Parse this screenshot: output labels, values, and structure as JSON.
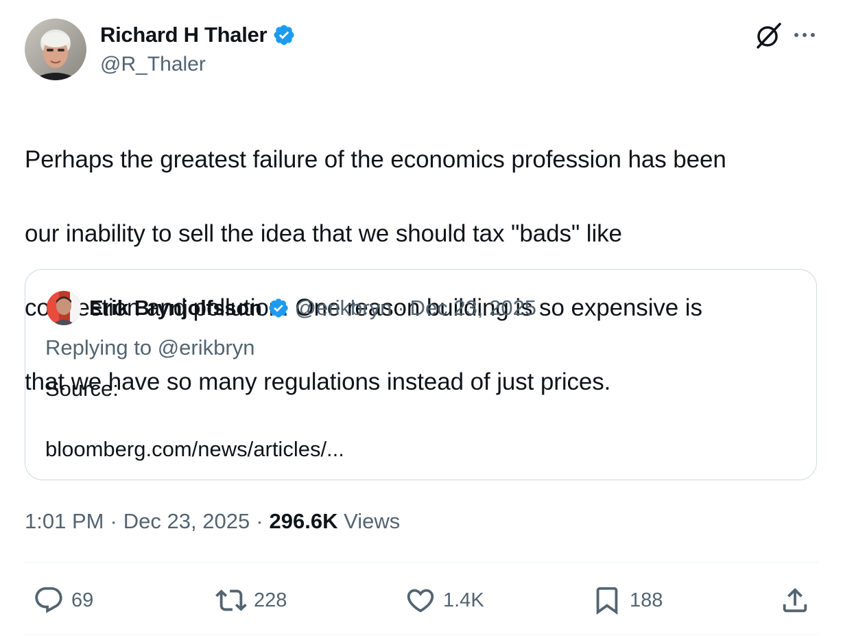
{
  "author": {
    "name": "Richard H Thaler",
    "handle": "@R_Thaler",
    "verified": true
  },
  "tweet": {
    "line1": "Perhaps the greatest failure of the economics profession has been",
    "line2": "our inability to sell the idea that we should tax \"bads\" like",
    "line3": "congestion and pollution. One reason building is so expensive is",
    "line4": "that we have so many regulations instead of just prices."
  },
  "quoted": {
    "name": "Erik Brynjolfsson",
    "handle": "@erikbryn",
    "separator": "·",
    "date": "Dec 23, 2025",
    "replying_to": "Replying to @erikbryn",
    "text": "Source:",
    "link": "bloomberg.com/news/articles/..."
  },
  "meta": {
    "time": "1:01 PM",
    "separator": "·",
    "date": "Dec 23, 2025",
    "views_count": "296.6K",
    "views_label": "Views"
  },
  "actions": {
    "replies": "69",
    "reposts": "228",
    "likes": "1.4K",
    "bookmarks": "188"
  },
  "icons": {
    "header": [
      "grok-icon",
      "more-icon"
    ],
    "actions": [
      "reply-icon",
      "repost-icon",
      "like-icon",
      "bookmark-icon",
      "share-icon"
    ]
  },
  "colors": {
    "verified": "#1d9bf0",
    "text": "#0f1419",
    "secondary": "#536471",
    "border": "#cfd9de"
  }
}
